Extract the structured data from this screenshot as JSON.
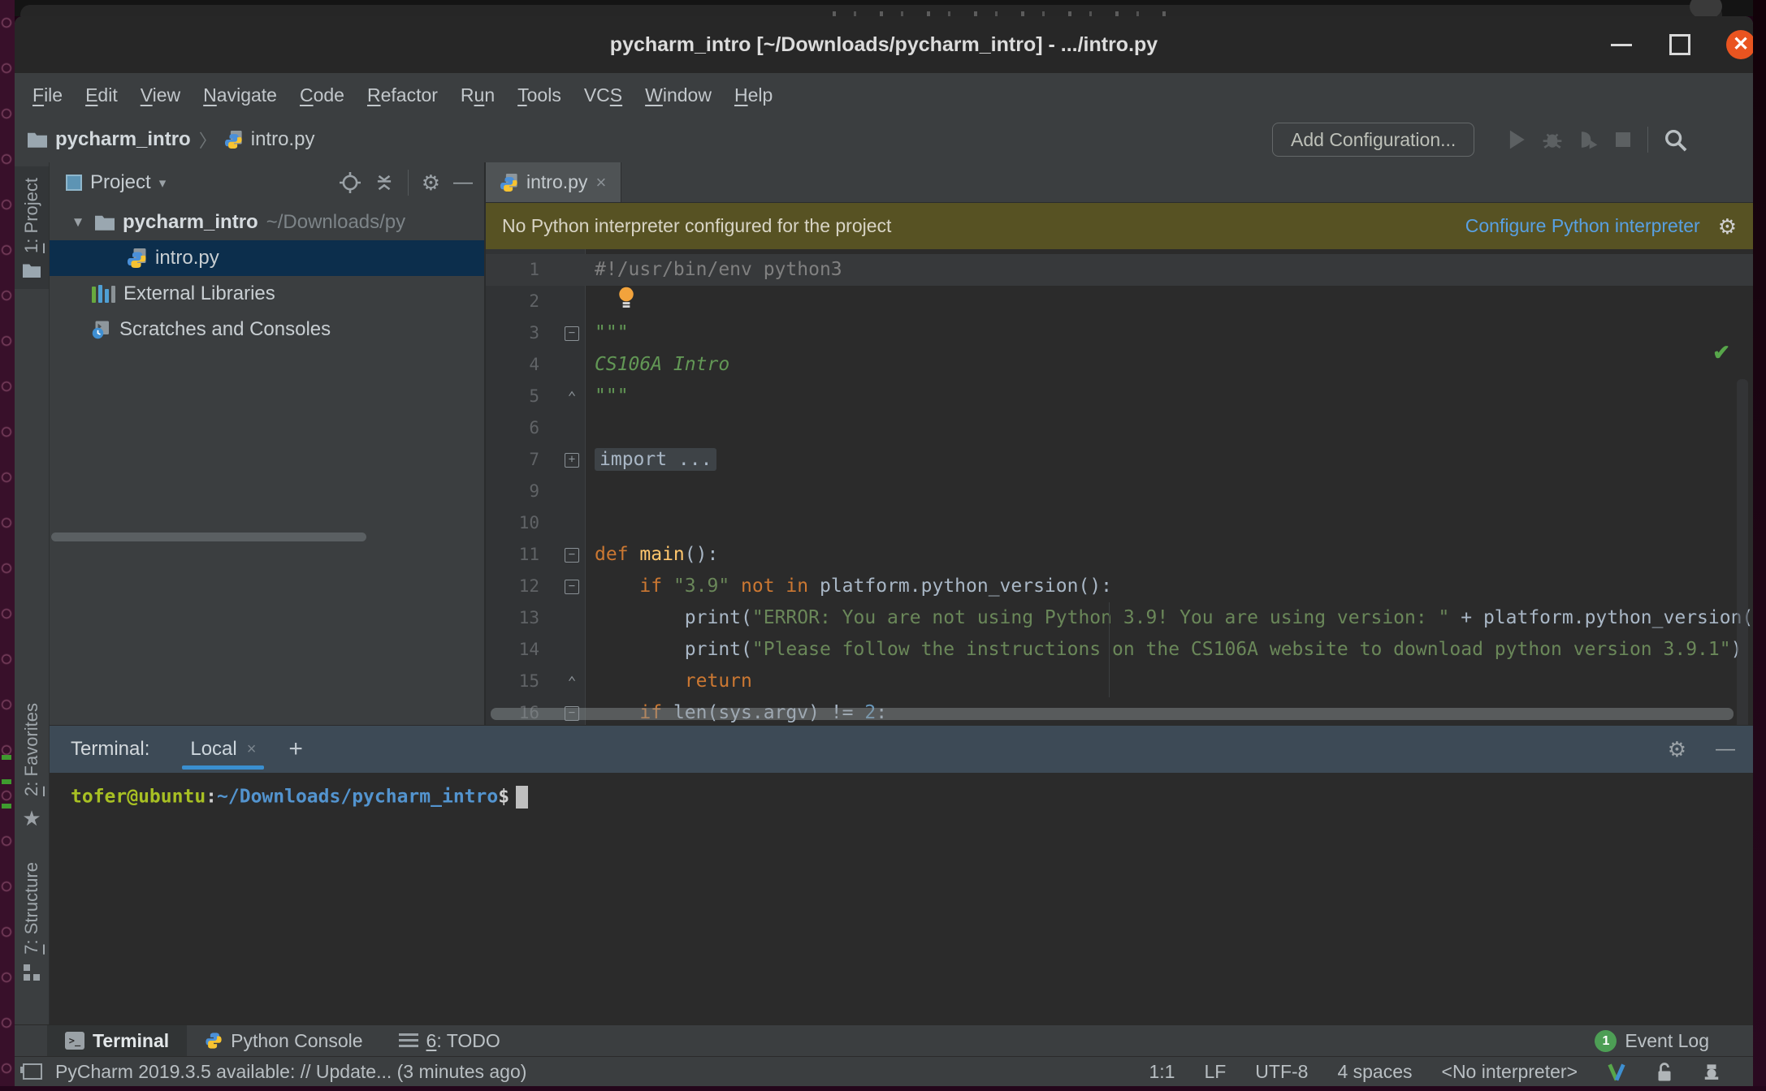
{
  "titlebar": {
    "title": "pycharm_intro [~/Downloads/pycharm_intro] - .../intro.py",
    "close_glyph": "✕"
  },
  "menubar": {
    "items": [
      {
        "label": "File",
        "u": 0
      },
      {
        "label": "Edit",
        "u": 0
      },
      {
        "label": "View",
        "u": 0
      },
      {
        "label": "Navigate",
        "u": 0
      },
      {
        "label": "Code",
        "u": 0
      },
      {
        "label": "Refactor",
        "u": 0
      },
      {
        "label": "Run",
        "u": 1
      },
      {
        "label": "Tools",
        "u": 0
      },
      {
        "label": "VCS",
        "u": 2
      },
      {
        "label": "Window",
        "u": 0
      },
      {
        "label": "Help",
        "u": 0
      }
    ]
  },
  "toolbar": {
    "breadcrumb_project": "pycharm_intro",
    "breadcrumb_sep": "〉",
    "breadcrumb_file": "intro.py",
    "add_configuration": "Add Configuration..."
  },
  "stripes": [
    {
      "label": "1: Project",
      "u": 0,
      "icon": "folder",
      "active": true
    },
    {
      "label": "2: Favorites",
      "u": 0,
      "icon": "star",
      "active": false
    },
    {
      "label": "7: Structure",
      "u": 0,
      "icon": "structure",
      "active": false
    }
  ],
  "project": {
    "header_title": "Project",
    "root_name": "pycharm_intro",
    "root_path": "~/Downloads/py",
    "file": "intro.py",
    "external": "External Libraries",
    "scratches": "Scratches and Consoles",
    "expander": "▼"
  },
  "editor": {
    "tab_label": "intro.py",
    "tab_close": "×",
    "banner": {
      "message": "No Python interpreter configured for the project",
      "action": "Configure Python interpreter"
    },
    "check": "✔",
    "lines": [
      {
        "num": "1",
        "caret": true,
        "seg": [
          [
            "c",
            "#!/usr/bin/env python3"
          ]
        ]
      },
      {
        "num": "2",
        "bulb": true
      },
      {
        "num": "3",
        "fold": "m",
        "seg": [
          [
            "d",
            "\"\"\""
          ]
        ]
      },
      {
        "num": "4",
        "seg": [
          [
            "d",
            "CS106A Intro"
          ]
        ]
      },
      {
        "num": "5",
        "fold": "u",
        "seg": [
          [
            "d",
            "\"\"\""
          ]
        ]
      },
      {
        "num": "6"
      },
      {
        "num": "7",
        "fold": "p",
        "folded": "import ..."
      },
      {
        "num": "9"
      },
      {
        "num": "10"
      },
      {
        "num": "11",
        "fold": "m",
        "seg": [
          [
            "k",
            "def "
          ],
          [
            "f",
            "main"
          ],
          [
            "p",
            "():"
          ]
        ]
      },
      {
        "num": "12",
        "fold": "m",
        "seg": [
          [
            "p",
            "    "
          ],
          [
            "k",
            "if "
          ],
          [
            "s",
            "\"3.9\""
          ],
          [
            "p",
            " "
          ],
          [
            "k",
            "not in"
          ],
          [
            "p",
            " platform.python_version():"
          ]
        ]
      },
      {
        "num": "13",
        "seg": [
          [
            "p",
            "        print("
          ],
          [
            "s",
            "\"ERROR: You are not using Python 3.9! You are using version: \""
          ],
          [
            "p",
            " + platform.python_version())"
          ]
        ]
      },
      {
        "num": "14",
        "seg": [
          [
            "p",
            "        print("
          ],
          [
            "s",
            "\"Please follow the instructions on the CS106A website to download python version 3.9.1\""
          ],
          [
            "p",
            ")"
          ]
        ]
      },
      {
        "num": "15",
        "fold": "u",
        "seg": [
          [
            "p",
            "        "
          ],
          [
            "k",
            "return"
          ]
        ]
      },
      {
        "num": "16",
        "fold": "m",
        "seg": [
          [
            "p",
            "    "
          ],
          [
            "k",
            "if "
          ],
          [
            "p",
            "len(sys.argv) != "
          ],
          [
            "n",
            "2"
          ],
          [
            "p",
            ":"
          ]
        ]
      }
    ]
  },
  "terminal": {
    "label": "Terminal:",
    "tab": "Local",
    "tab_close": "×",
    "new_tab": "+",
    "prompt": [
      [
        "user",
        "tofer@ubuntu"
      ],
      [
        "plain",
        ":"
      ],
      [
        "path",
        "~/Downloads/pycharm_intro"
      ],
      [
        "plain",
        "$"
      ]
    ]
  },
  "bottombar": {
    "tabs": [
      {
        "label": "Terminal",
        "icon": "terminal",
        "active": true
      },
      {
        "label": "Python Console",
        "icon": "python",
        "active": false
      },
      {
        "label": "6: TODO",
        "u": 0,
        "icon": "list",
        "active": false
      }
    ],
    "badge": "1",
    "event_log": "Event Log"
  },
  "statusbar": {
    "message": "PyCharm 2019.3.5 available: // Update... (3 minutes ago)",
    "items": [
      "1:1",
      "LF",
      "UTF-8",
      "4 spaces",
      "<No interpreter>"
    ]
  },
  "colors": {
    "accent_link": "#58a0e2",
    "banner_bg": "#575223",
    "selection_bg": "#0c2e4c",
    "close_button": "#e95420",
    "event_badge": "#4d9e55",
    "terminal_user": "#a8c023",
    "terminal_path": "#5394cf"
  }
}
